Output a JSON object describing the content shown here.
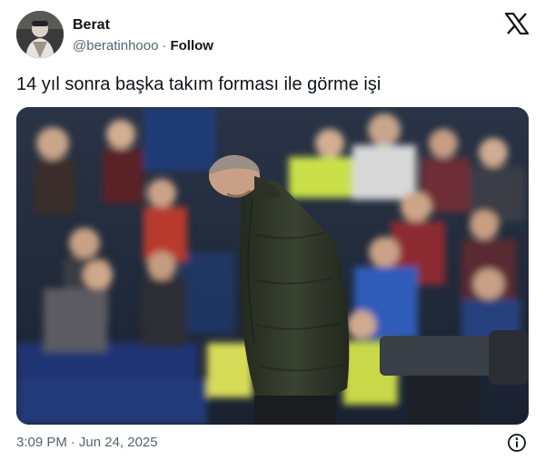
{
  "user": {
    "display_name": "Berat",
    "handle": "@beratinhooo",
    "separator": "·",
    "follow_label": "Follow"
  },
  "tweet": {
    "text": "14 yıl sonra başka takım forması ile görme işi"
  },
  "meta": {
    "time": "3:09 PM",
    "separator": "·",
    "date": "Jun 24, 2025"
  },
  "icons": {
    "platform_logo": "x-logo-icon",
    "info": "info-icon"
  },
  "colors": {
    "text_primary": "#0f1419",
    "text_secondary": "#536471",
    "coat": "#2f3628"
  }
}
